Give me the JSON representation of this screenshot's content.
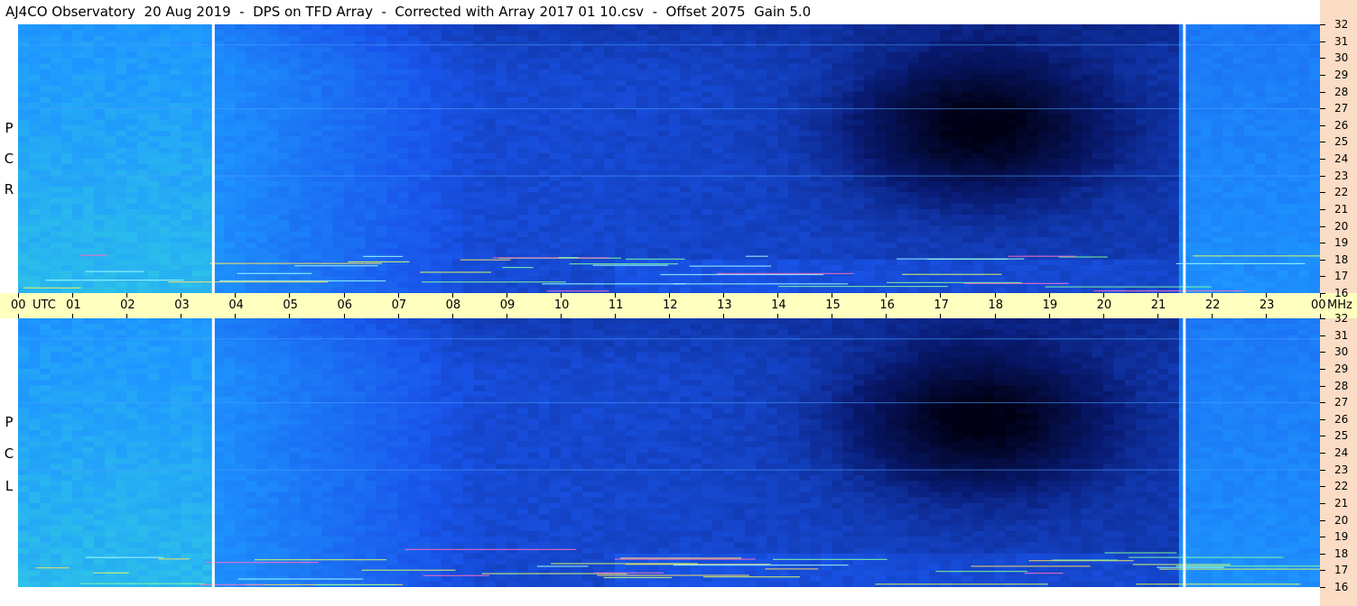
{
  "title": "AJ4CO Observatory  20 Aug 2019  -  DPS on TFD Array  -  Corrected with Array 2017 01 10.csv  -  Offset 2075  Gain 5.0",
  "panels": {
    "top": {
      "polarization_letters": [
        "P",
        "C",
        "R"
      ]
    },
    "bottom": {
      "polarization_letters": [
        "P",
        "C",
        "L"
      ]
    }
  },
  "time_axis": {
    "utc_label": "UTC",
    "unit_label": "MHz",
    "hour_labels": [
      "00",
      "01",
      "02",
      "03",
      "04",
      "05",
      "06",
      "07",
      "08",
      "09",
      "10",
      "11",
      "12",
      "13",
      "14",
      "15",
      "16",
      "17",
      "18",
      "19",
      "20",
      "21",
      "22",
      "23",
      "00"
    ]
  },
  "colors": {
    "time_axis_bg": "#ffffc0",
    "freq_axis_bg": "#fbdcc4",
    "spectrogram_low": "#000030",
    "spectrogram_mid": "#1e5cff",
    "spectrogram_high": "#3cd6c8"
  },
  "chart_data": {
    "type": "heatmap",
    "title": "AJ4CO Observatory  20 Aug 2019  -  DPS on TFD Array  -  Corrected with Array 2017 01 10.csv  -  Offset 2075  Gain 5.0",
    "xlabel": "UTC",
    "ylabel": "MHz",
    "x_range_hours": [
      0,
      24
    ],
    "y_range_mhz": [
      16,
      32
    ],
    "y_ticks": [
      16,
      17,
      18,
      19,
      20,
      21,
      22,
      23,
      24,
      25,
      26,
      27,
      28,
      29,
      30,
      31,
      32
    ],
    "x_ticks": [
      "00",
      "01",
      "02",
      "03",
      "04",
      "05",
      "06",
      "07",
      "08",
      "09",
      "10",
      "11",
      "12",
      "13",
      "14",
      "15",
      "16",
      "17",
      "18",
      "19",
      "20",
      "21",
      "22",
      "23",
      "00"
    ],
    "panels": [
      "RCP",
      "LCP"
    ],
    "vertical_markers_utc": [
      3.6,
      21.5
    ],
    "dark_region_utc": [
      15.0,
      20.5
    ]
  }
}
